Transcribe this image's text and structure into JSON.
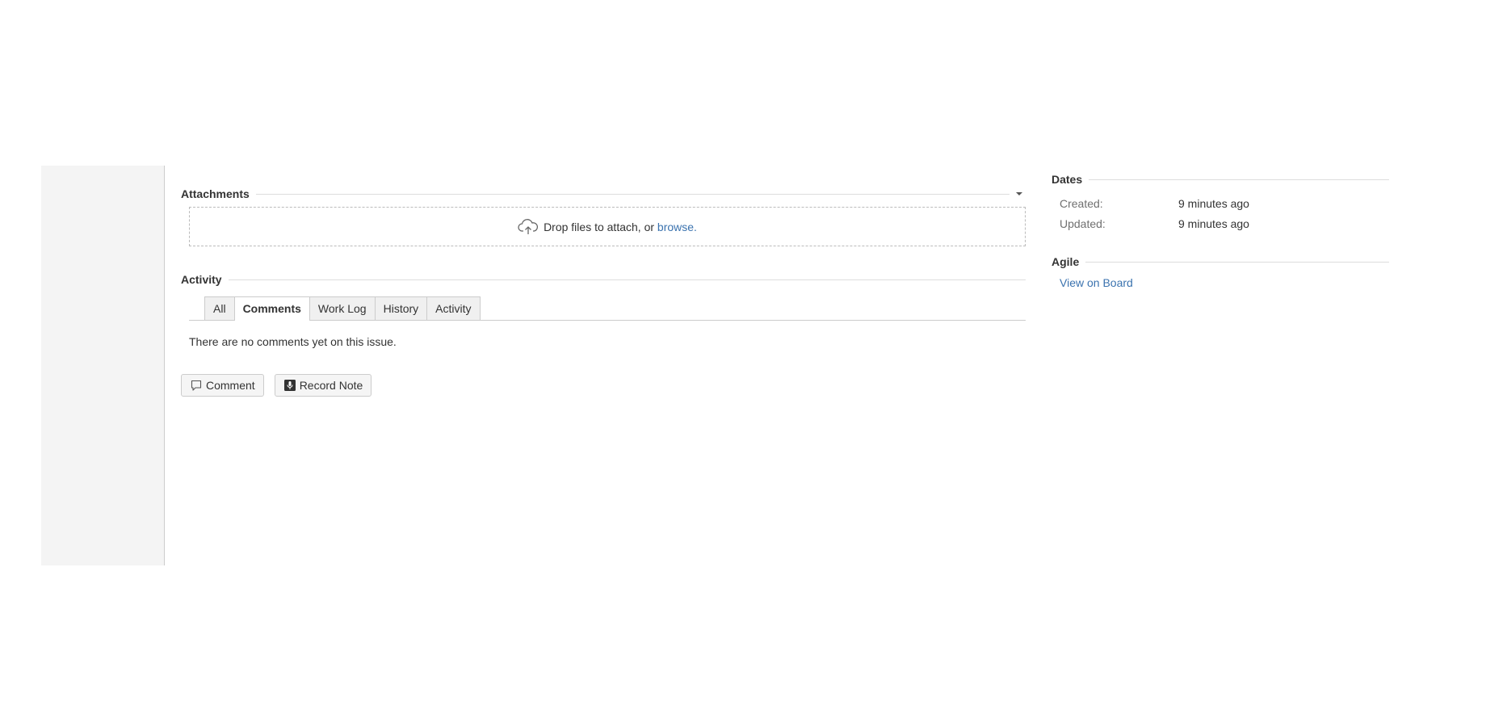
{
  "attachments": {
    "title": "Attachments",
    "drop_text": "Drop files to attach, or ",
    "browse_link": "browse",
    "drop_suffix": "."
  },
  "activity": {
    "title": "Activity",
    "tabs": [
      {
        "label": "All",
        "active": false
      },
      {
        "label": "Comments",
        "active": true
      },
      {
        "label": "Work Log",
        "active": false
      },
      {
        "label": "History",
        "active": false
      },
      {
        "label": "Activity",
        "active": false
      }
    ],
    "empty_message": "There are no comments yet on this issue.",
    "buttons": {
      "comment": "Comment",
      "record_note": "Record Note"
    }
  },
  "dates": {
    "title": "Dates",
    "created_label": "Created:",
    "created_value": "9 minutes ago",
    "updated_label": "Updated:",
    "updated_value": "9 minutes ago"
  },
  "agile": {
    "title": "Agile",
    "view_on_board": "View on Board"
  },
  "colors": {
    "link": "#3b73af",
    "sidebar_bg": "#f4f4f4"
  },
  "icons": {
    "upload": "cloud-upload-icon",
    "comment": "comment-icon",
    "record": "microphone-icon",
    "toggle": "chevron-down-icon"
  }
}
